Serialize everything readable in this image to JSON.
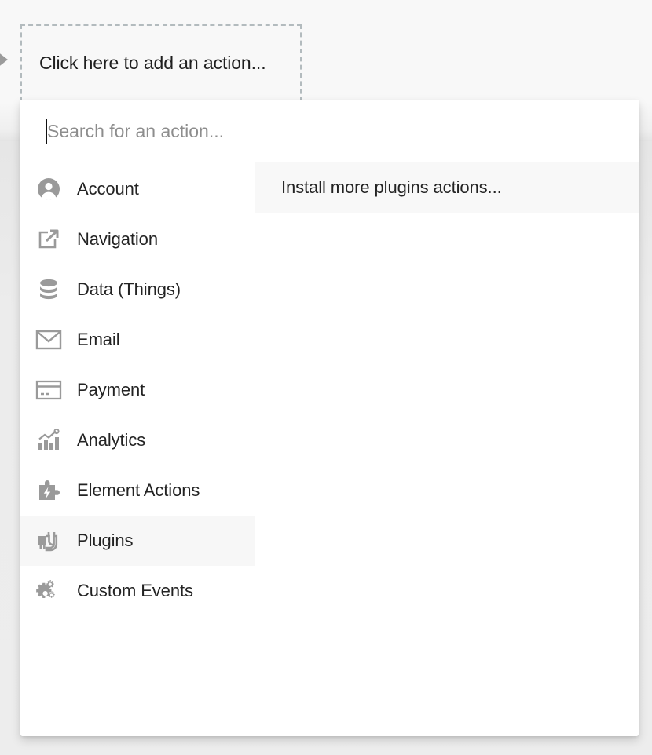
{
  "canvas": {
    "background_color": "#f8f8f8",
    "flow_arrow_icon": "triangle-right-icon"
  },
  "add_action_box": {
    "label": "Click here to add an action...",
    "border_style": "dashed",
    "border_color": "#b3bbbe"
  },
  "dropdown": {
    "search": {
      "placeholder": "Search for an action...",
      "value": "",
      "caret_visible": true
    },
    "categories": [
      {
        "label": "Account",
        "icon": "user-circle-icon",
        "selected": false
      },
      {
        "label": "Navigation",
        "icon": "external-link-icon",
        "selected": false
      },
      {
        "label": "Data (Things)",
        "icon": "database-icon",
        "selected": false
      },
      {
        "label": "Email",
        "icon": "envelope-icon",
        "selected": false
      },
      {
        "label": "Payment",
        "icon": "credit-card-icon",
        "selected": false
      },
      {
        "label": "Analytics",
        "icon": "bar-chart-line-icon",
        "selected": false
      },
      {
        "label": "Element Actions",
        "icon": "puzzle-bolt-icon",
        "selected": false
      },
      {
        "label": "Plugins",
        "icon": "plug-icon",
        "selected": true
      },
      {
        "label": "Custom Events",
        "icon": "gears-icon",
        "selected": false
      }
    ],
    "results": [
      {
        "label": "Install more plugins actions...",
        "highlighted": true
      }
    ],
    "colors": {
      "panel_background": "#ffffff",
      "selected_row": "#f7f7f7",
      "divider": "#e8e8e8",
      "icon": "#9a9a9a",
      "text": "#232323",
      "placeholder_text": "#8d8d8d"
    }
  }
}
